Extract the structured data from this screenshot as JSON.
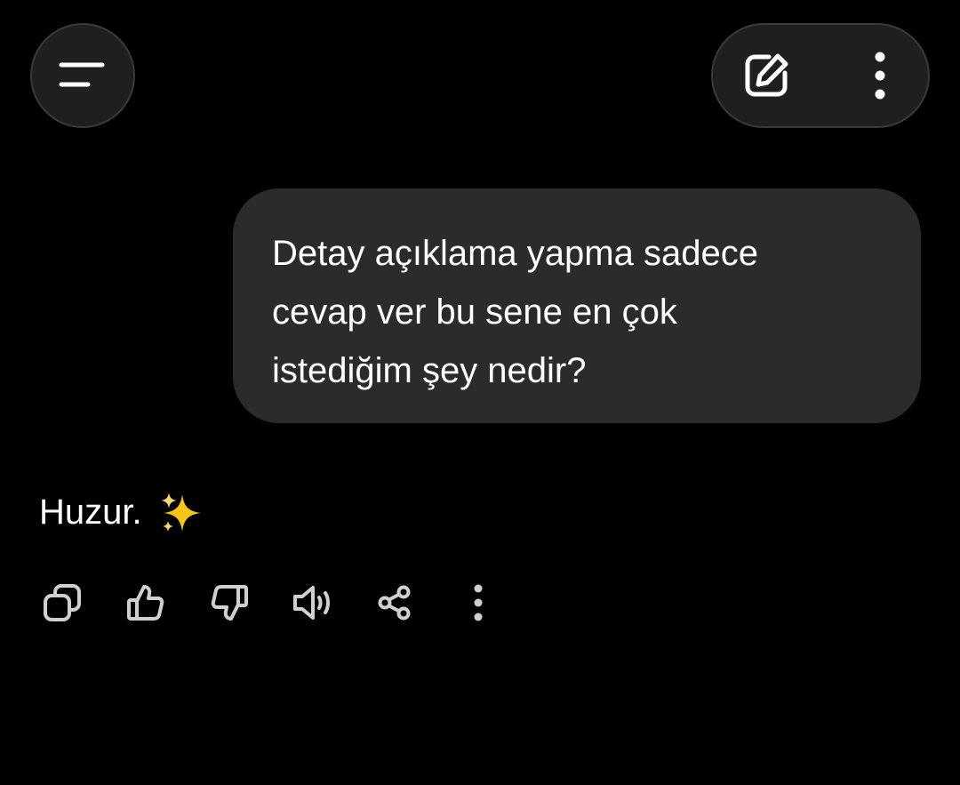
{
  "header": {
    "menu_icon": "menu-icon",
    "new_chat_icon": "edit-icon",
    "more_icon": "more-vertical-icon"
  },
  "conversation": {
    "user_message": {
      "lines": [
        "Detay açıklama yapma sadece",
        "cevap ver bu sene en çok",
        "istediğim şey nedir?"
      ]
    },
    "assistant_reply": {
      "text": "Huzur.",
      "emoji_icon": "sparkles-icon"
    }
  },
  "reply_actions": [
    {
      "icon": "copy-icon"
    },
    {
      "icon": "thumbs-up-icon"
    },
    {
      "icon": "thumbs-down-icon"
    },
    {
      "icon": "speaker-icon"
    },
    {
      "icon": "share-icon"
    },
    {
      "icon": "more-vertical-icon"
    }
  ],
  "colors": {
    "background": "#000000",
    "bubble": "#2b2b2b",
    "button_bg": "#1f1f1f",
    "button_border": "#3a3a3a",
    "text": "#ffffff",
    "icon_muted": "#d0d0d0",
    "sparkle": "#f5c518"
  }
}
